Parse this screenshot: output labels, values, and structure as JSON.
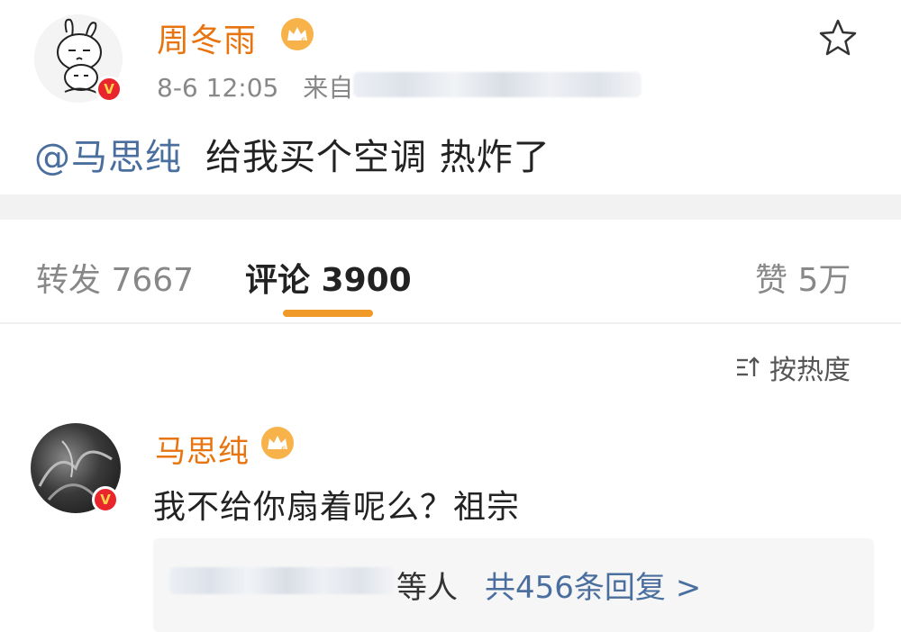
{
  "post": {
    "author": "周冬雨",
    "time": "8-6 12:05",
    "source_prefix": "来自",
    "mention": "@马思纯",
    "text": "给我买个空调 热炸了"
  },
  "tabs": [
    {
      "label": "转发 7667"
    },
    {
      "label": "评论 3900"
    },
    {
      "label": "赞 5万"
    }
  ],
  "sort": {
    "label": "按热度"
  },
  "comment": {
    "author": "马思纯",
    "text": "我不给你扇着呢么？祖宗",
    "reply_suffix": "等人",
    "reply_count": "共456条回复 >"
  },
  "colors": {
    "name_orange": "#e8740f",
    "link_blue": "#4a6f9e",
    "verified_red": "#e8262c",
    "tab_indicator": "#f09a2a"
  }
}
